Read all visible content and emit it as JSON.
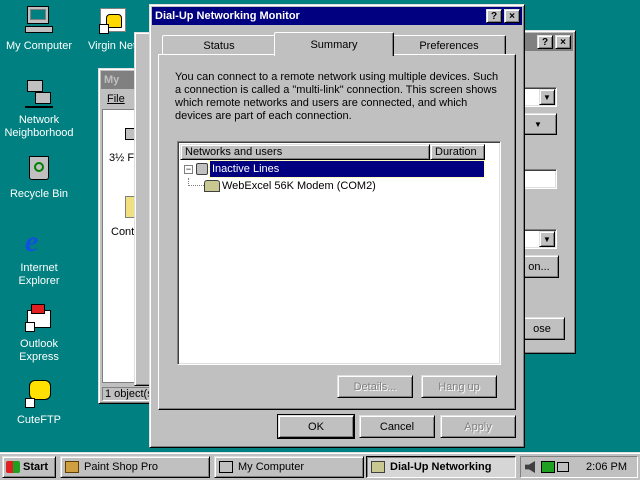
{
  "desktop": {
    "icons": [
      {
        "label": "My Computer"
      },
      {
        "label": "Virgin Net"
      },
      {
        "label": "Network Neighborhood"
      },
      {
        "label": "Recycle Bin"
      },
      {
        "label": "Internet Explorer"
      },
      {
        "label": "Outlook Express"
      },
      {
        "label": "CuteFTP"
      }
    ]
  },
  "mycomputer_window": {
    "title": "My",
    "menu_file": "File",
    "item_floppy": "3½ Fl",
    "item_control": "Contr",
    "status": "1 object(s"
  },
  "right_window": {
    "button_partial": "on...",
    "close_partial": "ose"
  },
  "dialog": {
    "title": "Dial-Up Networking Monitor",
    "help_btn": "?",
    "close_btn": "×",
    "tabs": [
      {
        "label": "Status"
      },
      {
        "label": "Summary"
      },
      {
        "label": "Preferences"
      }
    ],
    "description": "You can connect to a remote network using multiple devices. Such a connection is called a \"multi-link\" connection. This screen shows which remote networks and users are connected, and which devices are part of each connection.",
    "list": {
      "col_networks": "Networks and users",
      "col_duration": "Duration",
      "items": [
        {
          "label": "Inactive Lines",
          "expander": "−",
          "selected": true
        },
        {
          "label": "WebExcel 56K Modem (COM2)",
          "selected": false
        }
      ]
    },
    "details_btn": "Details...",
    "hangup_btn": "Hang up",
    "ok_btn": "OK",
    "cancel_btn": "Cancel",
    "apply_btn": "Apply"
  },
  "taskbar": {
    "start": "Start",
    "tasks": [
      {
        "label": "Paint Shop Pro",
        "active": false
      },
      {
        "label": "My Computer",
        "active": false
      },
      {
        "label": "Dial-Up Networking",
        "active": true
      }
    ],
    "clock": "2:06 PM"
  },
  "colors": {
    "desktop": "#008080",
    "title_active": "#000080",
    "face": "#c0c0c0"
  }
}
